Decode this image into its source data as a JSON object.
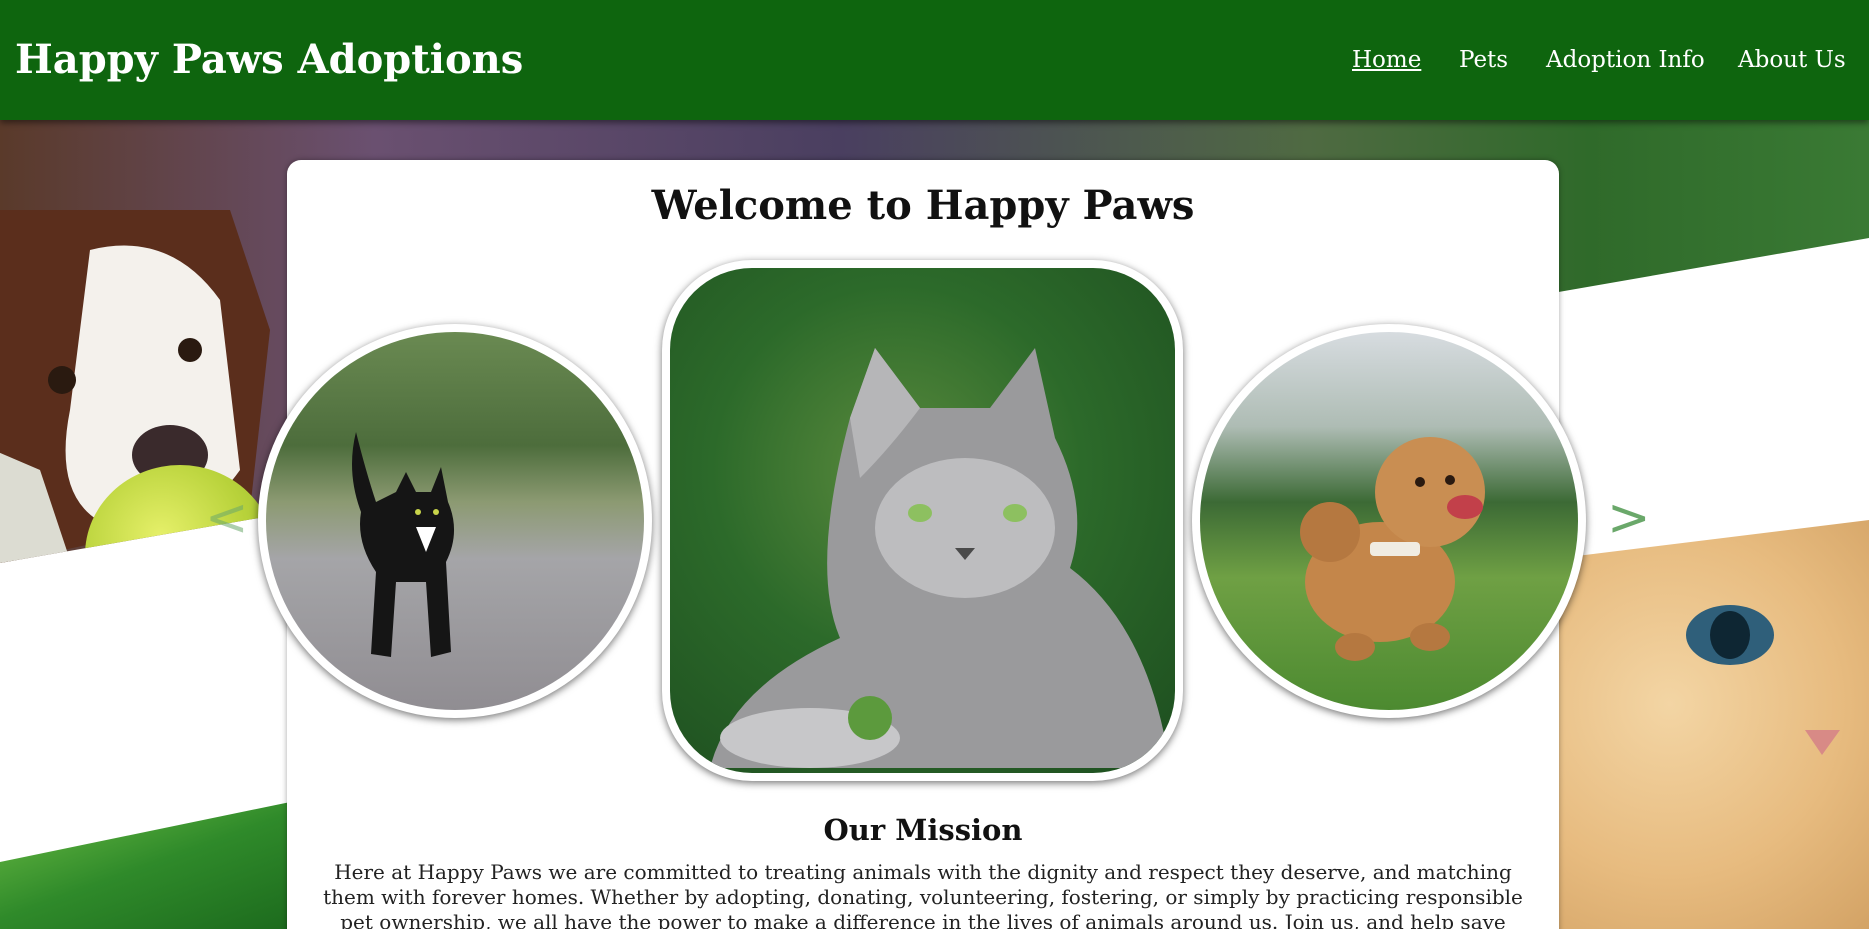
{
  "header": {
    "brand": "Happy Paws Adoptions",
    "nav": [
      {
        "label": "Home",
        "active": true
      },
      {
        "label": "Pets",
        "active": false
      },
      {
        "label": "Adoption Info",
        "active": false
      },
      {
        "label": "About Us",
        "active": false
      }
    ]
  },
  "main": {
    "title": "Welcome to Happy Paws",
    "carousel": {
      "prev_label": "<",
      "next_label": ">",
      "slides": [
        {
          "subject": "black cat on path",
          "shape": "circle"
        },
        {
          "subject": "grey long-haired cat",
          "shape": "rounded-square",
          "active": true
        },
        {
          "subject": "fluffy brown puppy running",
          "shape": "circle"
        }
      ]
    },
    "mission": {
      "title": "Our Mission",
      "text": "Here at Happy Paws we are committed to treating animals with the dignity and respect they deserve, and matching them with forever homes. Whether by adopting, donating, volunteering, fostering, or simply by practicing responsible pet ownership, we all have the power to make a difference in the lives of animals around us. Join us, and help save lives today!"
    }
  },
  "colors": {
    "header_bg": "#0e650e",
    "header_text": "#ffffff",
    "arrow": "#6aa86a"
  }
}
